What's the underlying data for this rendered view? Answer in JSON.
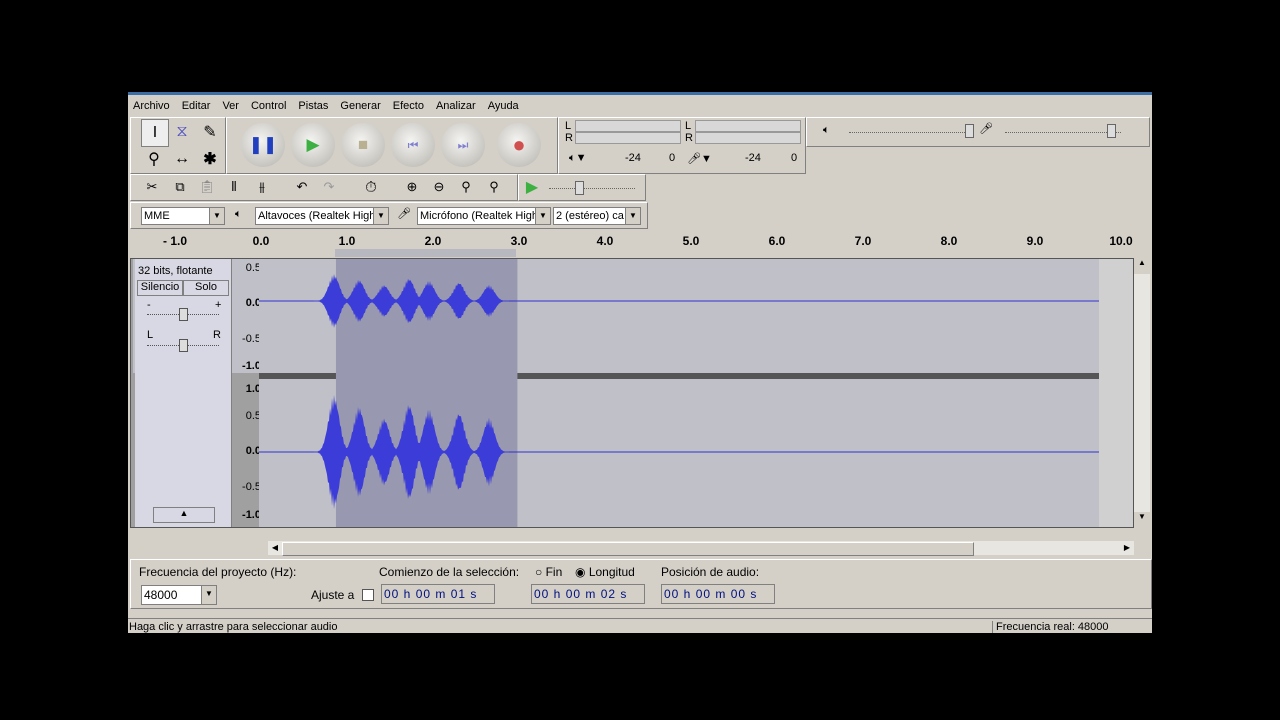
{
  "menu": [
    "Archivo",
    "Editar",
    "Ver",
    "Control",
    "Pistas",
    "Generar",
    "Efecto",
    "Analizar",
    "Ayuda"
  ],
  "meter": {
    "L": "L",
    "R": "R",
    "minus24": "-24",
    "zero": "0",
    "minus24b": "-24",
    "zerob": "0"
  },
  "device": {
    "host": "MME",
    "output": "Altavoces (Realtek High",
    "input": "Micrófono (Realtek High",
    "channels": "2 (estéreo) ca"
  },
  "ruler": [
    "- 1.0",
    "0.0",
    "1.0",
    "2.0",
    "3.0",
    "4.0",
    "5.0",
    "6.0",
    "7.0",
    "8.0",
    "9.0",
    "10.0"
  ],
  "track": {
    "format": "32 bits, flotante",
    "mute": "Silencio",
    "solo": "Solo",
    "gain_minus": "-",
    "gain_plus": "+",
    "pan_l": "L",
    "pan_r": "R"
  },
  "scale1": [
    "0.5",
    "0.0",
    "-0.5",
    "-1.0"
  ],
  "scale2": [
    "1.0",
    "0.5",
    "0.0",
    "-0.5",
    "-1.0"
  ],
  "selection_seconds": {
    "start": 0.86,
    "end": 2.97
  },
  "selbar": {
    "rate_label": "Frecuencia del proyecto (Hz):",
    "rate": "48000",
    "snap": "Ajuste a",
    "sel_label": "Comienzo de la selección:",
    "fin": "Fin",
    "longitud": "Longitud",
    "start": "00 h 00 m 01 s",
    "length": "00 h 00 m 02 s",
    "pos_label": "Posición de audio:",
    "pos": "00 h 00 m 00 s"
  },
  "status": {
    "left": "Haga clic y arrastre para seleccionar audio",
    "right": "Frecuencia real: 48000"
  }
}
